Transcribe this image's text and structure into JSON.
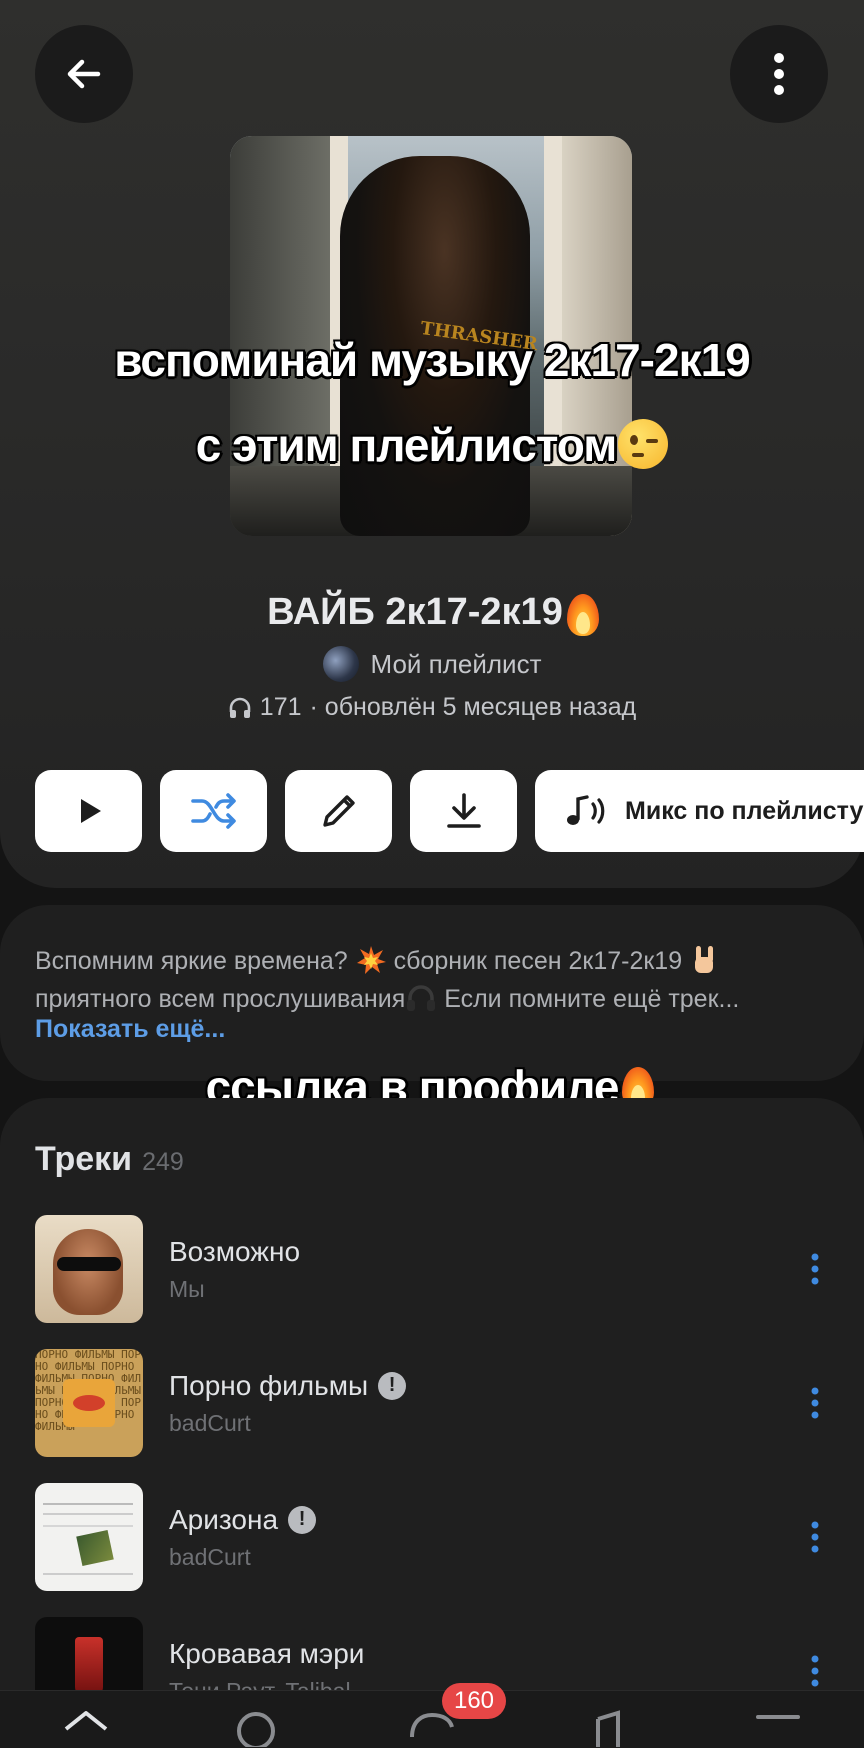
{
  "header": {
    "back_icon": "arrow-left-icon",
    "more_icon": "more-vertical-icon"
  },
  "overlay": {
    "line1": "вспоминай музыку 2к17-2к19",
    "line2": "с этим плейлистом",
    "line3": "ссылка в профиле"
  },
  "playlist": {
    "title": "ВАЙБ 2к17-2к19",
    "owner": "Мой плейлист",
    "listens": "171",
    "updated": "· обновлён 5 месяцев назад"
  },
  "actions": {
    "play_icon": "play-icon",
    "shuffle_icon": "shuffle-icon",
    "edit_icon": "pencil-icon",
    "download_icon": "download-icon",
    "mix_label": "Микс по плейлисту"
  },
  "description": {
    "line1_a": "Вспомним яркие времена?",
    "line1_b": "сборник песен 2к17-2к19",
    "line2_a": "приятного всем прослушивания",
    "line2_b": "Если помните ещё трек...",
    "show_more": "Показать ещё..."
  },
  "tracks": {
    "title": "Треки",
    "count": "249",
    "items": [
      {
        "title": "Возможно",
        "artist": "Мы",
        "explicit": false
      },
      {
        "title": "Порно фильмы",
        "artist": "badCurt",
        "explicit": true
      },
      {
        "title": "Аризона",
        "artist": "badCurt",
        "explicit": true
      },
      {
        "title": "Кровавая мэри",
        "artist": "Тони Раут, Talibal",
        "explicit": false
      }
    ]
  },
  "cover_print": "THRASHER",
  "cover2_text": "ПОРНО ФИЛЬМЫ ПОРНО ФИЛЬМЫ ПОРНО ФИЛЬМЫ ПОРНО ФИЛЬМЫ ПОРНО ФИЛЬМЫ ПОРНО ФИЛЬМЫ ПОРНО ФИЛЬМЫ ПОРНО ФИЛЬМЫ",
  "nav": {
    "messages_badge": "160"
  },
  "colors": {
    "accent": "#5d9de6",
    "shuffle": "#3f8ae0",
    "badge": "#e64646"
  }
}
